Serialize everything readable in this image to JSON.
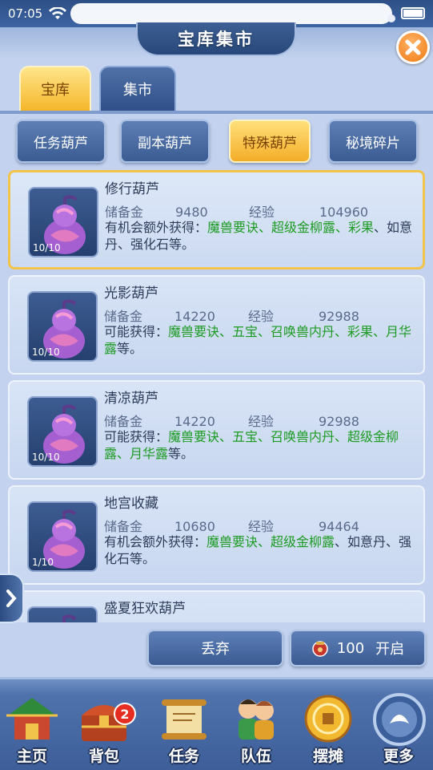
{
  "status_bar": {
    "time": "07:05"
  },
  "header": {
    "title": "宝库集市"
  },
  "tabs": [
    {
      "label": "宝库",
      "active": true
    },
    {
      "label": "集市",
      "active": false
    }
  ],
  "filters": [
    {
      "label": "任务葫芦",
      "active": false
    },
    {
      "label": "副本葫芦",
      "active": false
    },
    {
      "label": "特殊葫芦",
      "active": true
    },
    {
      "label": "秘境碎片",
      "active": false
    }
  ],
  "items": [
    {
      "name": "修行葫芦",
      "count": "10/10",
      "gold_label": "储备金",
      "gold": "9480",
      "exp_label": "经验",
      "exp": "104960",
      "desc_prefix": "有机会额外获得：",
      "desc_green": "魔兽要诀、超级金柳露、彩果",
      "desc_suffix": "、如意丹、强化石等。"
    },
    {
      "name": "光影葫芦",
      "count": "10/10",
      "gold_label": "储备金",
      "gold": "14220",
      "exp_label": "经验",
      "exp": "92988",
      "desc_prefix": "可能获得：",
      "desc_green": "魔兽要诀、五宝、召唤兽内丹、彩果、月华露",
      "desc_suffix": "等。"
    },
    {
      "name": "清凉葫芦",
      "count": "10/10",
      "gold_label": "储备金",
      "gold": "14220",
      "exp_label": "经验",
      "exp": "92988",
      "desc_prefix": "可能获得：",
      "desc_green": "魔兽要诀、五宝、召唤兽内丹、超级金柳露、月华露",
      "desc_suffix": "等。"
    },
    {
      "name": "地宫收藏",
      "count": "1/10",
      "gold_label": "储备金",
      "gold": "10680",
      "exp_label": "经验",
      "exp": "94464",
      "desc_prefix": "有机会额外获得：",
      "desc_green": "魔兽要诀、超级金柳露",
      "desc_suffix": "、如意丹、强化石等。"
    },
    {
      "name": "盛夏狂欢葫芦",
      "count": "",
      "gold_label": "",
      "gold": "",
      "exp_label": "",
      "exp": "",
      "desc_prefix": "",
      "desc_green": "",
      "desc_suffix": ""
    }
  ],
  "actions": {
    "discard": "丢弃",
    "open_cost": "100",
    "open_label": "开启"
  },
  "bottom_nav": [
    {
      "label": "主页",
      "icon": "home-pavilion-icon"
    },
    {
      "label": "背包",
      "icon": "treasure-chest-icon",
      "badge": "2"
    },
    {
      "label": "任务",
      "icon": "scroll-icon"
    },
    {
      "label": "队伍",
      "icon": "team-icon"
    },
    {
      "label": "摆摊",
      "icon": "coin-icon"
    },
    {
      "label": "更多",
      "icon": "more-icon"
    }
  ],
  "colors": {
    "accent_gold": "#f5b62a",
    "panel_blue": "#c3d2ee",
    "reward_green": "#1d9b23",
    "close_orange": "#f07a12"
  }
}
